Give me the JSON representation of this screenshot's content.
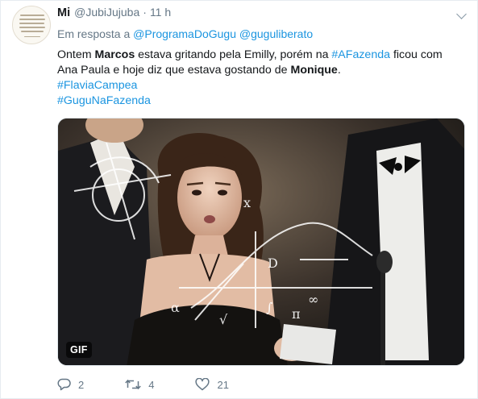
{
  "tweet": {
    "author_name": "Mi",
    "author_handle": "@JubiJujuba",
    "separator": "·",
    "time": "11 h",
    "reply_prefix": "Em resposta a",
    "reply_handle_1": "@ProgramaDoGugu",
    "reply_handle_2": "@guguliberato",
    "body": {
      "t1": "Ontem ",
      "b1": "Marcos",
      "t2": " estava gritando pela Emilly, porém na ",
      "hashtag_1": "#AFazenda",
      "t3": " ficou com Ana Paula e hoje diz que estava gostando de ",
      "b2": "Monique",
      "t4": ".",
      "hashtag_2": "#FlaviaCampea",
      "hashtag_3": "#GuguNaFazenda"
    },
    "media": {
      "badge": "GIF"
    },
    "actions": {
      "replies": "2",
      "retweets": "4",
      "likes": "21"
    }
  },
  "colors": {
    "link": "#1b95e0",
    "muted": "#657786",
    "text": "#14171a",
    "border": "#e6ecf0"
  },
  "icons": {
    "reply": "reply-bubble-icon",
    "retweet": "retweet-arrows-icon",
    "like": "heart-icon",
    "caret": "chevron-down-icon"
  }
}
